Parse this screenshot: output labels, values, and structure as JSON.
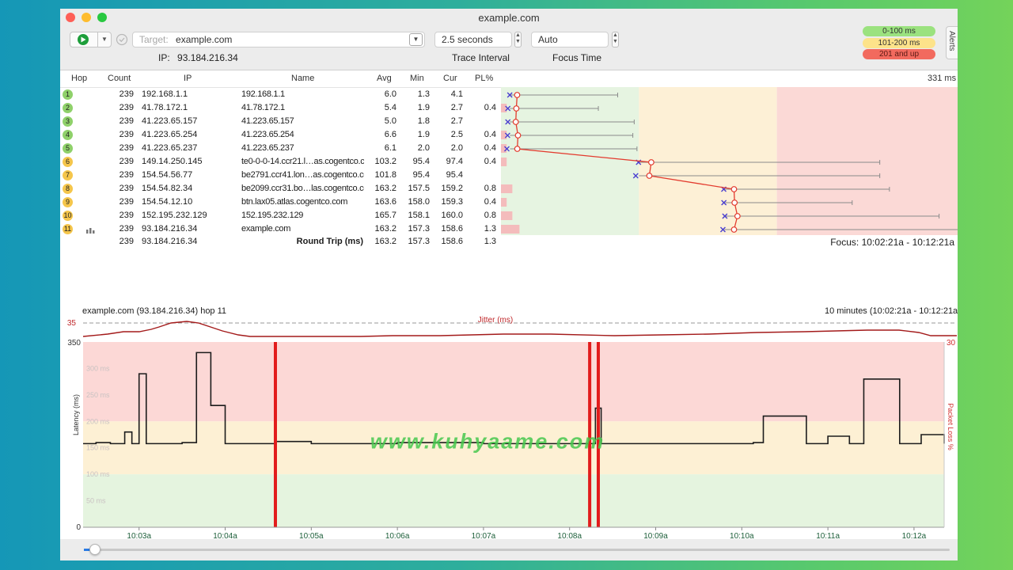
{
  "window": {
    "title": "example.com"
  },
  "toolbar": {
    "target_label": "Target:",
    "target_value": "example.com",
    "ip_label": "IP:",
    "ip_value": "93.184.216.34",
    "interval_value": "2.5 seconds",
    "interval_label": "Trace Interval",
    "focus_value": "Auto",
    "focus_label": "Focus Time"
  },
  "legend": [
    {
      "label": "0-100 ms",
      "color": "#9be27f"
    },
    {
      "label": "101-200 ms",
      "color": "#fde38a"
    },
    {
      "label": "201 and up",
      "color": "#f26a5e"
    }
  ],
  "alerts_label": "Alerts",
  "table": {
    "headers": {
      "hop": "Hop",
      "count": "Count",
      "ip": "IP",
      "name": "Name",
      "avg": "Avg",
      "min": "Min",
      "cur": "Cur",
      "pl": "PL%"
    },
    "scale_label": "331 ms",
    "rows": [
      {
        "hop": "1",
        "count": "239",
        "ip": "192.168.1.1",
        "name": "192.168.1.1",
        "avg": "6.0",
        "min": "1.3",
        "cur": "4.1",
        "pl": "",
        "badge": "#8fd16a",
        "avg_v": 6.0,
        "min_v": 1.3,
        "cur_v": 4.1,
        "max_v": 80,
        "pl_v": 0
      },
      {
        "hop": "2",
        "count": "239",
        "ip": "41.78.172.1",
        "name": "41.78.172.1",
        "avg": "5.4",
        "min": "1.9",
        "cur": "2.7",
        "pl": "0.4",
        "badge": "#8fd16a",
        "avg_v": 5.4,
        "min_v": 1.9,
        "cur_v": 2.7,
        "max_v": 66,
        "pl_v": 0.4
      },
      {
        "hop": "3",
        "count": "239",
        "ip": "41.223.65.157",
        "name": "41.223.65.157",
        "avg": "5.0",
        "min": "1.8",
        "cur": "2.7",
        "pl": "",
        "badge": "#8fd16a",
        "avg_v": 5.0,
        "min_v": 1.8,
        "cur_v": 2.7,
        "max_v": 92,
        "pl_v": 0
      },
      {
        "hop": "4",
        "count": "239",
        "ip": "41.223.65.254",
        "name": "41.223.65.254",
        "avg": "6.6",
        "min": "1.9",
        "cur": "2.5",
        "pl": "0.4",
        "badge": "#8fd16a",
        "avg_v": 6.6,
        "min_v": 1.9,
        "cur_v": 2.5,
        "max_v": 91,
        "pl_v": 0.4
      },
      {
        "hop": "5",
        "count": "239",
        "ip": "41.223.65.237",
        "name": "41.223.65.237",
        "avg": "6.1",
        "min": "2.0",
        "cur": "2.0",
        "pl": "0.4",
        "badge": "#8fd16a",
        "avg_v": 6.1,
        "min_v": 2.0,
        "cur_v": 2.0,
        "max_v": 94,
        "pl_v": 0.4
      },
      {
        "hop": "6",
        "count": "239",
        "ip": "149.14.250.145",
        "name": "te0-0-0-14.ccr21.l…as.cogentco.com",
        "avg": "103.2",
        "min": "95.4",
        "cur": "97.4",
        "pl": "0.4",
        "badge": "#f5c64b",
        "avg_v": 103.2,
        "min_v": 95.4,
        "cur_v": 97.4,
        "max_v": 270,
        "pl_v": 0.4
      },
      {
        "hop": "7",
        "count": "239",
        "ip": "154.54.56.77",
        "name": "be2791.ccr41.lon…as.cogentco.com",
        "avg": "101.8",
        "min": "95.4",
        "cur": "95.4",
        "pl": "",
        "badge": "#f5c64b",
        "avg_v": 101.8,
        "min_v": 95.4,
        "cur_v": 95.4,
        "max_v": 270,
        "pl_v": 0
      },
      {
        "hop": "8",
        "count": "239",
        "ip": "154.54.82.34",
        "name": "be2099.ccr31.bo…las.cogentco.com",
        "avg": "163.2",
        "min": "157.5",
        "cur": "159.2",
        "pl": "0.8",
        "badge": "#f5c64b",
        "avg_v": 163.2,
        "min_v": 157.5,
        "cur_v": 159.2,
        "max_v": 277,
        "pl_v": 0.8
      },
      {
        "hop": "9",
        "count": "239",
        "ip": "154.54.12.10",
        "name": "btn.lax05.atlas.cogentco.com",
        "avg": "163.6",
        "min": "158.0",
        "cur": "159.3",
        "pl": "0.4",
        "badge": "#f5c64b",
        "avg_v": 163.6,
        "min_v": 158.0,
        "cur_v": 159.3,
        "max_v": 250,
        "pl_v": 0.4
      },
      {
        "hop": "10",
        "count": "239",
        "ip": "152.195.232.129",
        "name": "152.195.232.129",
        "avg": "165.7",
        "min": "158.1",
        "cur": "160.0",
        "pl": "0.8",
        "badge": "#f5c64b",
        "avg_v": 165.7,
        "min_v": 158.1,
        "cur_v": 160.0,
        "max_v": 313,
        "pl_v": 0.8
      },
      {
        "hop": "11",
        "count": "239",
        "ip": "93.184.216.34",
        "name": "example.com",
        "avg": "163.2",
        "min": "157.3",
        "cur": "158.6",
        "pl": "1.3",
        "badge": "#f5c64b",
        "avg_v": 163.2,
        "min_v": 157.3,
        "cur_v": 158.6,
        "max_v": 331,
        "pl_v": 1.3
      }
    ],
    "summary": {
      "count": "239",
      "ip": "93.184.216.34",
      "name": "Round Trip (ms)",
      "avg": "163.2",
      "min": "157.3",
      "cur": "158.6",
      "pl": "1.3"
    },
    "focus_text": "Focus: 10:02:21a - 10:12:21a"
  },
  "graph": {
    "title": "example.com (93.184.216.34) hop 11",
    "range": "10 minutes (10:02:21a - 10:12:21a)",
    "jitter_label": "Jitter (ms)",
    "jitter_max": "35",
    "y_max": "350",
    "y_min": "0",
    "y_label": "Latency (ms)",
    "loss_label": "Packet Loss %",
    "loss_max": "30",
    "gridlines": [
      "300 ms",
      "250 ms",
      "200 ms",
      "150 ms",
      "100 ms",
      "50 ms"
    ],
    "xticks": [
      "10:03a",
      "10:04a",
      "10:05a",
      "10:06a",
      "10:07a",
      "10:08a",
      "10:09a",
      "10:10a",
      "10:11a",
      "10:12a"
    ]
  },
  "watermark": "www.kuhyaame.com",
  "chart_data": {
    "type": "line",
    "title": "example.com (93.184.216.34) hop 11",
    "xlabel": "",
    "ylabel": "Latency (ms)",
    "ylim": [
      0,
      350
    ],
    "x": [
      "10:02:21a",
      "10:02:30a",
      "10:02:40a",
      "10:02:50a",
      "10:02:55a",
      "10:03:00a",
      "10:03:05a",
      "10:03:30a",
      "10:03:40a",
      "10:03:50a",
      "10:04:00a",
      "10:04:35a",
      "10:05:00a",
      "10:06:00a",
      "10:07:00a",
      "10:08:00a",
      "10:08:12a",
      "10:08:18a",
      "10:08:22a",
      "10:09:00a",
      "10:10:00a",
      "10:10:08a",
      "10:10:15a",
      "10:10:45a",
      "10:11:00a",
      "10:11:15a",
      "10:11:25a",
      "10:11:50a",
      "10:12:05a",
      "10:12:21a"
    ],
    "series": [
      {
        "values": [
          158,
          160,
          158,
          180,
          158,
          290,
          158,
          160,
          330,
          230,
          158,
          162,
          158,
          160,
          158,
          158,
          158,
          225,
          158,
          158,
          158,
          160,
          210,
          158,
          172,
          158,
          280,
          158,
          175,
          158
        ]
      }
    ],
    "packet_loss_events": [
      "10:04:35a",
      "10:08:14a",
      "10:08:20a"
    ],
    "loss_ylim": [
      0,
      30
    ]
  }
}
